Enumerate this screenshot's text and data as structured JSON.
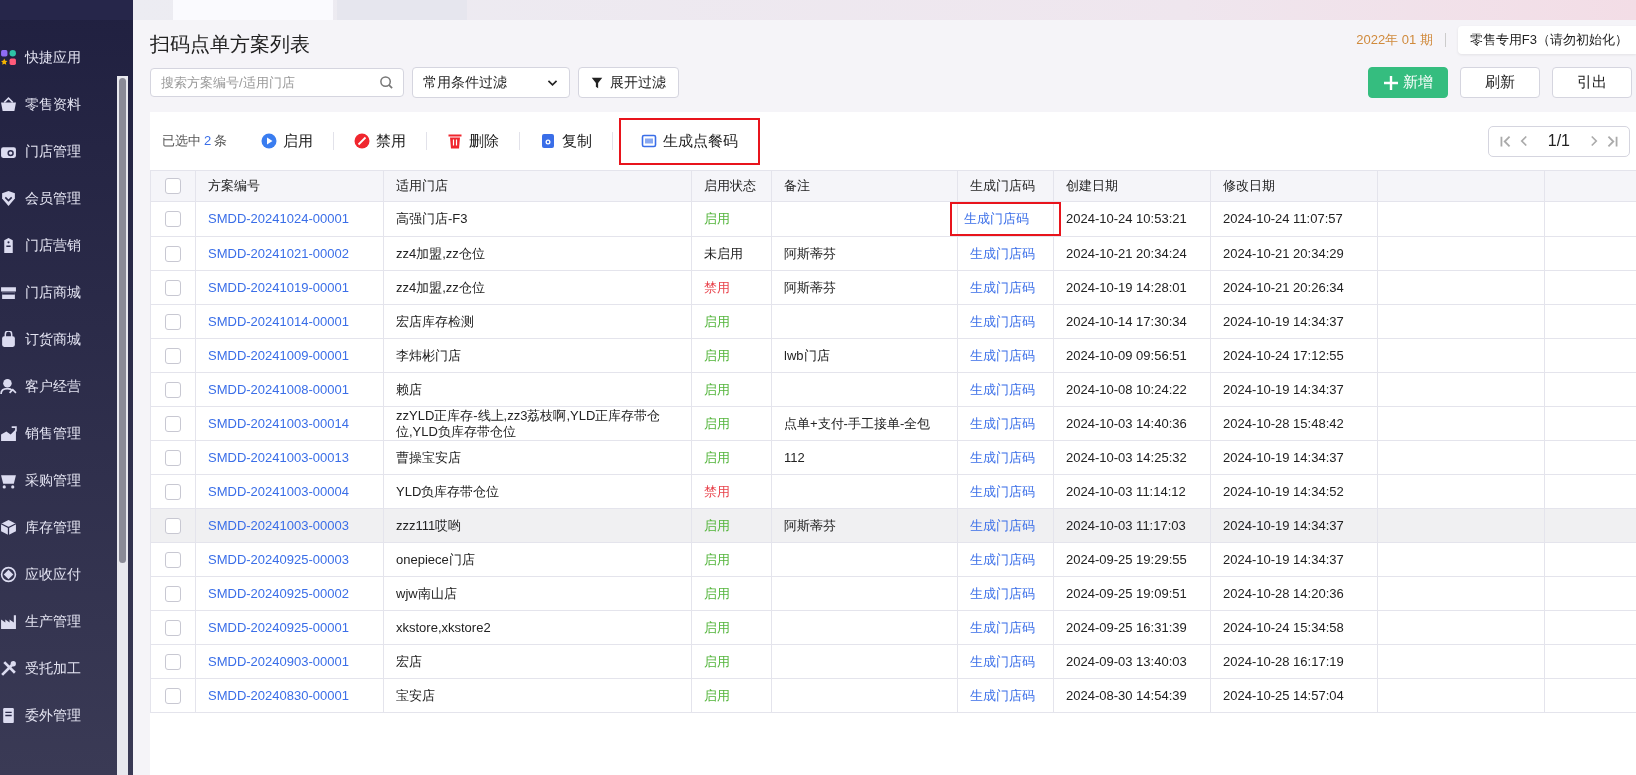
{
  "sidebar": {
    "items": [
      {
        "label": "快捷应用",
        "selected": false
      },
      {
        "label": "零售资料",
        "selected": false
      },
      {
        "label": "门店管理",
        "selected": false
      },
      {
        "label": "会员管理",
        "selected": false
      },
      {
        "label": "门店营销",
        "selected": false
      },
      {
        "label": "门店商城",
        "selected": false
      },
      {
        "label": "订货商城",
        "selected": false
      },
      {
        "label": "客户经营",
        "selected": false
      },
      {
        "label": "销售管理",
        "selected": false
      },
      {
        "label": "采购管理",
        "selected": false
      },
      {
        "label": "库存管理",
        "selected": false
      },
      {
        "label": "应收应付",
        "selected": false
      },
      {
        "label": "生产管理",
        "selected": false
      },
      {
        "label": "受托加工",
        "selected": false
      },
      {
        "label": "委外管理",
        "selected": false
      }
    ]
  },
  "page": {
    "title": "扫码点单方案列表",
    "period": "2022年 01 期",
    "account": "零售专用F3（请勿初始化）"
  },
  "filters": {
    "search": {
      "placeholder": "搜索方案编号/适用门店"
    },
    "preset": "常用条件过滤",
    "expand": "展开过滤"
  },
  "actions": [
    {
      "label": "新增",
      "kind": "primary"
    },
    {
      "label": "刷新",
      "kind": "default"
    },
    {
      "label": "引出",
      "kind": "default"
    }
  ],
  "toolbar": {
    "selection_prefix": "已选中",
    "selection_count": "2",
    "selection_suffix": "条",
    "buttons": [
      {
        "label": "启用",
        "kind": "enable",
        "highlighted": false
      },
      {
        "label": "禁用",
        "kind": "disable",
        "highlighted": false
      },
      {
        "label": "删除",
        "kind": "delete",
        "highlighted": false
      },
      {
        "label": "复制",
        "kind": "copy",
        "highlighted": false
      },
      {
        "label": "生成点餐码",
        "kind": "generate",
        "highlighted": true
      }
    ]
  },
  "pagination": {
    "page": "1/1"
  },
  "table": {
    "all_checked": false,
    "columns": [
      "方案编号",
      "适用门店",
      "启用状态",
      "备注",
      "生成门店码",
      "创建日期",
      "修改日期"
    ],
    "rows": [
      {
        "checked": false,
        "hovered": false,
        "code": "SMDD-20241024-00001",
        "store": "高强门店-F3",
        "status": "启用",
        "color": "#52b43a",
        "action": "生成门店码",
        "action_highlighted": true,
        "created": "2024-10-24 10:53:21",
        "modified": "2024-10-24 11:07:57"
      },
      {
        "checked": false,
        "hovered": false,
        "code": "SMDD-20241021-00002",
        "store": "zz4加盟,zz仓位",
        "status": "未启用",
        "color": "#222222",
        "remark": "阿斯蒂芬",
        "action": "生成门店码",
        "action_highlighted": false,
        "created": "2024-10-21 20:34:24",
        "modified": "2024-10-21 20:34:29"
      },
      {
        "checked": false,
        "hovered": false,
        "code": "SMDD-20241019-00001",
        "store": "zz4加盟,zz仓位",
        "status": "禁用",
        "color": "#e8414a",
        "remark": "阿斯蒂芬",
        "action": "生成门店码",
        "action_highlighted": false,
        "created": "2024-10-19 14:28:01",
        "modified": "2024-10-21 20:26:34"
      },
      {
        "checked": false,
        "hovered": false,
        "code": "SMDD-20241014-00001",
        "store": "宏店库存检测",
        "status": "启用",
        "color": "#52b43a",
        "action": "生成门店码",
        "action_highlighted": false,
        "created": "2024-10-14 17:30:34",
        "modified": "2024-10-19 14:34:37"
      },
      {
        "checked": false,
        "hovered": false,
        "code": "SMDD-20241009-00001",
        "store": "李炜彬门店",
        "status": "启用",
        "color": "#52b43a",
        "remark": "lwb门店",
        "action": "生成门店码",
        "action_highlighted": false,
        "created": "2024-10-09 09:56:51",
        "modified": "2024-10-24 17:12:55"
      },
      {
        "checked": false,
        "hovered": false,
        "code": "SMDD-20241008-00001",
        "store": "赖店",
        "status": "启用",
        "color": "#52b43a",
        "action": "生成门店码",
        "action_highlighted": false,
        "created": "2024-10-08 10:24:22",
        "modified": "2024-10-19 14:34:37"
      },
      {
        "checked": false,
        "hovered": false,
        "code": "SMDD-20241003-00014",
        "store": "zzYLD正库存-线上,zz3荔枝啊,YLD正库存带仓位,YLD负库存带仓位",
        "status": "启用",
        "color": "#52b43a",
        "remark": "点单+支付-手工接单-全包",
        "action": "生成门店码",
        "action_highlighted": false,
        "created": "2024-10-03 14:40:36",
        "modified": "2024-10-28 15:48:42"
      },
      {
        "checked": false,
        "hovered": false,
        "code": "SMDD-20241003-00013",
        "store": "曹操宝安店",
        "status": "启用",
        "color": "#52b43a",
        "remark": "112",
        "action": "生成门店码",
        "action_highlighted": false,
        "created": "2024-10-03 14:25:32",
        "modified": "2024-10-19 14:34:37"
      },
      {
        "checked": false,
        "hovered": false,
        "code": "SMDD-20241003-00004",
        "store": "YLD负库存带仓位",
        "status": "禁用",
        "color": "#e8414a",
        "action": "生成门店码",
        "action_highlighted": false,
        "created": "2024-10-03 11:14:12",
        "modified": "2024-10-19 14:34:52"
      },
      {
        "checked": false,
        "hovered": true,
        "code": "SMDD-20241003-00003",
        "store": "zzz111哎哟",
        "status": "启用",
        "color": "#52b43a",
        "remark": "阿斯蒂芬",
        "action": "生成门店码",
        "action_highlighted": false,
        "created": "2024-10-03 11:17:03",
        "modified": "2024-10-19 14:34:37"
      },
      {
        "checked": false,
        "hovered": false,
        "code": "SMDD-20240925-00003",
        "store": "onepiece门店",
        "status": "启用",
        "color": "#52b43a",
        "action": "生成门店码",
        "action_highlighted": false,
        "created": "2024-09-25 19:29:55",
        "modified": "2024-10-19 14:34:37"
      },
      {
        "checked": false,
        "hovered": false,
        "code": "SMDD-20240925-00002",
        "store": "wjw南山店",
        "status": "启用",
        "color": "#52b43a",
        "action": "生成门店码",
        "action_highlighted": false,
        "created": "2024-09-25 19:09:51",
        "modified": "2024-10-28 14:20:36"
      },
      {
        "checked": false,
        "hovered": false,
        "code": "SMDD-20240925-00001",
        "store": "xkstore,xkstore2",
        "status": "启用",
        "color": "#52b43a",
        "action": "生成门店码",
        "action_highlighted": false,
        "created": "2024-09-25 16:31:39",
        "modified": "2024-10-24 15:34:58"
      },
      {
        "checked": false,
        "hovered": false,
        "code": "SMDD-20240903-00001",
        "store": "宏店",
        "status": "启用",
        "color": "#52b43a",
        "action": "生成门店码",
        "action_highlighted": false,
        "created": "2024-09-03 13:40:03",
        "modified": "2024-10-28 16:17:19"
      },
      {
        "checked": false,
        "hovered": false,
        "code": "SMDD-20240830-00001",
        "store": "宝安店",
        "status": "启用",
        "color": "#52b43a",
        "action": "生成门店码",
        "action_highlighted": false,
        "created": "2024-08-30 14:54:39",
        "modified": "2024-10-25 14:57:04"
      }
    ]
  }
}
